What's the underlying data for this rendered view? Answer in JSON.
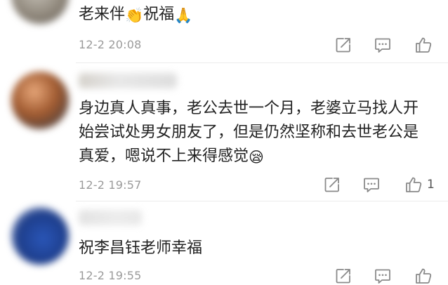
{
  "comments": [
    {
      "username": "",
      "text_lines": [
        "老来伴",
        "祝福"
      ],
      "emojis": [
        "👏",
        "🙏"
      ],
      "time": "12-2 20:08",
      "like_count": ""
    },
    {
      "username": "",
      "text_lines": [
        "身边真人真事，老公去世一个月，老婆立马找人开",
        "始尝试处男女朋友了，但是仍然坚称和去世老公是",
        "真爱，嗯说不上来得感觉"
      ],
      "emojis": [
        "😪"
      ],
      "time": "12-2 19:57",
      "like_count": "1"
    },
    {
      "username": "",
      "text_lines": [
        "祝李昌钰老师幸福"
      ],
      "emojis": [],
      "time": "12-2 19:55",
      "like_count": ""
    }
  ],
  "icons": {
    "share": "share-icon",
    "reply": "comment-icon",
    "like": "thumbs-up-icon"
  },
  "colors": {
    "text": "#222222",
    "meta": "#9a9a9a",
    "icon": "#8a8a8a"
  }
}
